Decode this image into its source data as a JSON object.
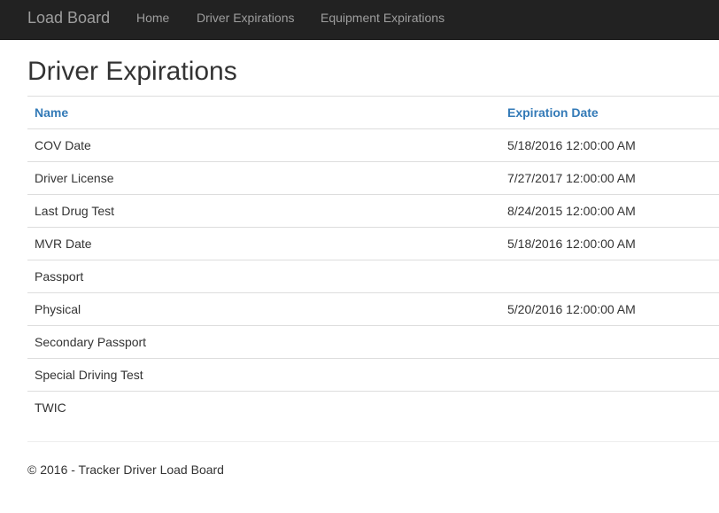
{
  "navbar": {
    "brand": "Load Board",
    "links": [
      {
        "label": "Home"
      },
      {
        "label": "Driver Expirations"
      },
      {
        "label": "Equipment Expirations"
      }
    ]
  },
  "page": {
    "title": "Driver Expirations"
  },
  "table": {
    "columns": {
      "name": "Name",
      "expiration_date": "Expiration Date"
    },
    "rows": [
      {
        "name": "COV Date",
        "expiration_date": "5/18/2016 12:00:00 AM"
      },
      {
        "name": "Driver License",
        "expiration_date": "7/27/2017 12:00:00 AM"
      },
      {
        "name": "Last Drug Test",
        "expiration_date": "8/24/2015 12:00:00 AM"
      },
      {
        "name": "MVR Date",
        "expiration_date": "5/18/2016 12:00:00 AM"
      },
      {
        "name": "Passport",
        "expiration_date": ""
      },
      {
        "name": "Physical",
        "expiration_date": "5/20/2016 12:00:00 AM"
      },
      {
        "name": "Secondary Passport",
        "expiration_date": ""
      },
      {
        "name": "Special Driving Test",
        "expiration_date": ""
      },
      {
        "name": "TWIC",
        "expiration_date": ""
      }
    ]
  },
  "footer": {
    "text": "© 2016 - Tracker Driver Load Board"
  },
  "colors": {
    "navbar_bg": "#222222",
    "nav_text": "#9d9d9d",
    "header_link": "#337ab7",
    "body_text": "#333333",
    "row_border": "#dddddd"
  }
}
